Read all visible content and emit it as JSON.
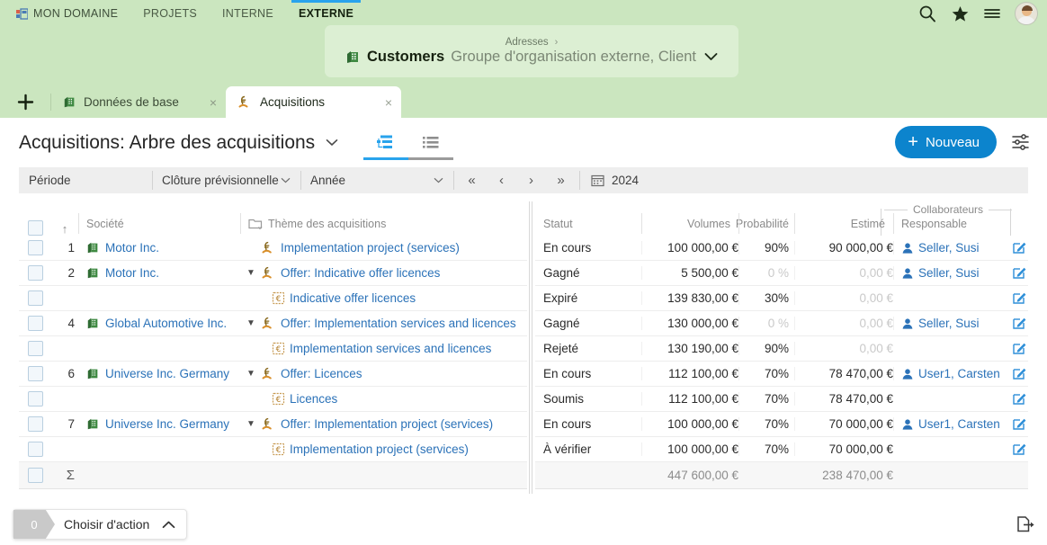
{
  "topnav": {
    "home_label": "MON DOMAINE",
    "items": [
      {
        "label": "PROJETS",
        "active": false
      },
      {
        "label": "INTERNE",
        "active": false
      },
      {
        "label": "EXTERNE",
        "active": true
      }
    ],
    "icons": [
      "search-icon",
      "star-icon",
      "menu-icon",
      "user-avatar"
    ]
  },
  "context_card": {
    "breadcrumb": "Adresses",
    "breadcrumb_separator": "›",
    "name": "Customers",
    "description": "Groupe d'organisation externe, Client",
    "chevron": "⌄"
  },
  "tabs": {
    "add_label": "+",
    "items": [
      {
        "label": "Données de base",
        "icon": "building-icon",
        "active": false,
        "close": "×"
      },
      {
        "label": "Acquisitions",
        "icon": "acquisition-icon",
        "active": true,
        "close": "×"
      }
    ]
  },
  "page_header": {
    "title": "Acquisitions: Arbre des acquisitions",
    "title_chevron": "⌄",
    "view_toggles": [
      {
        "name": "tree-view",
        "active": true
      },
      {
        "name": "list-view",
        "active": false
      }
    ],
    "new_button": "Nouveau",
    "new_button_plus": "+",
    "new_button_color": "#0c84cd",
    "settings_icon": "sliders-icon"
  },
  "filterbar": {
    "period_label": "Période",
    "closing_label": "Clôture prévisionnelle",
    "range_label": "Année",
    "nav": [
      "«",
      "‹",
      "›",
      "»"
    ],
    "date_value": "2024",
    "date_icon": "calendar-icon"
  },
  "table": {
    "column_group": "Collaborateurs",
    "headers_left": [
      "Société",
      "Thème des acquisitions"
    ],
    "sort_indicator": "↑",
    "folder_icon": "folder-icon",
    "headers_right": [
      "Statut",
      "Volumes",
      "Probabilité",
      "Estimé",
      "Responsable"
    ],
    "rows": [
      {
        "num": "1",
        "company": "Motor Inc.",
        "company_icon": "building-icon",
        "theme": "Implementation project (services)",
        "theme_icon": "acquisition-icon",
        "level": 0,
        "twisty": "",
        "statut": "En cours",
        "volumes": "100 000,00 €",
        "probabilite": "90%",
        "estime": "90 000,00 €",
        "estime_muted": false,
        "prob_muted": false,
        "responsable": "Seller, Susi",
        "responsable_icon": "person-icon",
        "edit_icon": "edit-icon"
      },
      {
        "num": "2",
        "company": "Motor Inc.",
        "company_icon": "building-icon",
        "theme": "Offer: Indicative offer licences",
        "theme_icon": "acquisition-icon",
        "level": 0,
        "twisty": "▼",
        "statut": "Gagné",
        "volumes": "5 500,00 €",
        "probabilite": "0 %",
        "estime": "0,00 €",
        "estime_muted": true,
        "prob_muted": true,
        "responsable": "Seller, Susi",
        "responsable_icon": "person-icon",
        "edit_icon": "edit-icon"
      },
      {
        "num": "",
        "company": "",
        "company_icon": "",
        "theme": "Indicative offer licences",
        "theme_icon": "euro-doc-icon",
        "level": 1,
        "twisty": "",
        "statut": "Expiré",
        "volumes": "139 830,00 €",
        "probabilite": "30%",
        "estime": "0,00 €",
        "estime_muted": true,
        "prob_muted": false,
        "responsable": "",
        "responsable_icon": "",
        "edit_icon": "edit-icon"
      },
      {
        "num": "4",
        "company": "Global Automotive Inc.",
        "company_icon": "building-icon",
        "theme": "Offer: Implementation services and licences",
        "theme_icon": "acquisition-icon",
        "level": 0,
        "twisty": "▼",
        "statut": "Gagné",
        "volumes": "130 000,00 €",
        "probabilite": "0 %",
        "estime": "0,00 €",
        "estime_muted": true,
        "prob_muted": true,
        "responsable": "Seller, Susi",
        "responsable_icon": "person-icon",
        "edit_icon": "edit-icon"
      },
      {
        "num": "",
        "company": "",
        "company_icon": "",
        "theme": "Implementation services and licences",
        "theme_icon": "euro-doc-icon",
        "level": 1,
        "twisty": "",
        "statut": "Rejeté",
        "volumes": "130 190,00 €",
        "probabilite": "90%",
        "estime": "0,00 €",
        "estime_muted": true,
        "prob_muted": false,
        "responsable": "",
        "responsable_icon": "",
        "edit_icon": "edit-icon"
      },
      {
        "num": "6",
        "company": "Universe Inc. Germany",
        "company_icon": "building-icon",
        "theme": "Offer: Licences",
        "theme_icon": "acquisition-icon",
        "level": 0,
        "twisty": "▼",
        "statut": "En cours",
        "volumes": "112 100,00 €",
        "probabilite": "70%",
        "estime": "78 470,00 €",
        "estime_muted": false,
        "prob_muted": false,
        "responsable": "User1, Carsten",
        "responsable_icon": "person-icon",
        "edit_icon": "edit-icon"
      },
      {
        "num": "",
        "company": "",
        "company_icon": "",
        "theme": "Licences",
        "theme_icon": "euro-doc-icon",
        "level": 1,
        "twisty": "",
        "statut": "Soumis",
        "volumes": "112 100,00 €",
        "probabilite": "70%",
        "estime": "78 470,00 €",
        "estime_muted": false,
        "prob_muted": false,
        "responsable": "",
        "responsable_icon": "",
        "edit_icon": "edit-icon"
      },
      {
        "num": "7",
        "company": "Universe Inc. Germany",
        "company_icon": "building-icon",
        "theme": "Offer: Implementation project (services)",
        "theme_icon": "acquisition-icon",
        "level": 0,
        "twisty": "▼",
        "statut": "En cours",
        "volumes": "100 000,00 €",
        "probabilite": "70%",
        "estime": "70 000,00 €",
        "estime_muted": false,
        "prob_muted": false,
        "responsable": "User1, Carsten",
        "responsable_icon": "person-icon",
        "edit_icon": "edit-icon"
      },
      {
        "num": "",
        "company": "",
        "company_icon": "",
        "theme": "Implementation project (services)",
        "theme_icon": "euro-doc-icon",
        "level": 1,
        "twisty": "",
        "statut": "À vérifier",
        "volumes": "100 000,00 €",
        "probabilite": "70%",
        "estime": "70 000,00 €",
        "estime_muted": false,
        "prob_muted": false,
        "responsable": "",
        "responsable_icon": "",
        "edit_icon": "edit-icon"
      }
    ],
    "summary": {
      "symbol": "Σ",
      "volumes": "447 600,00 €",
      "estime": "238 470,00 €"
    }
  },
  "bottombar": {
    "count": "0",
    "action_label": "Choisir d'action",
    "chevron": "⌃",
    "export_icon": "export-icon"
  }
}
